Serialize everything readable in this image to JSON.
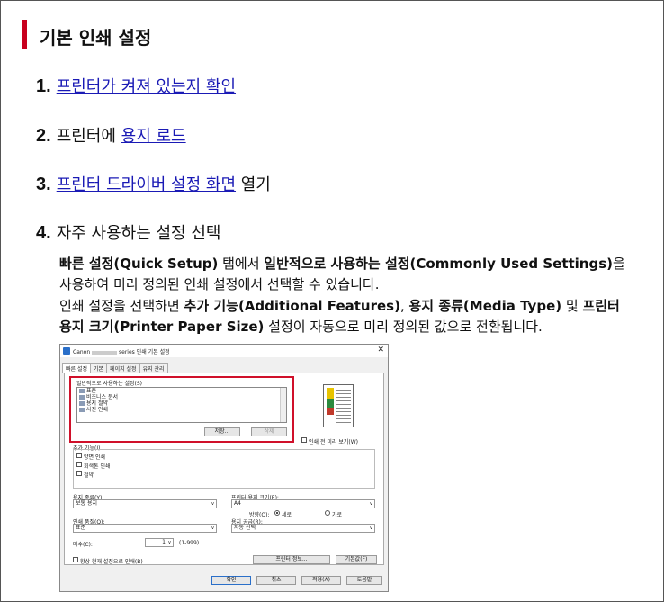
{
  "section_title": "기본 인쇄 설정",
  "steps": [
    {
      "num": "1.",
      "link": "프린터가 켜져 있는지 확인"
    },
    {
      "num": "2.",
      "prefix": "프린터에 ",
      "link": "용지 로드"
    },
    {
      "num": "3.",
      "link": "프린터 드라이버 설정 화면",
      "suffix": " 열기"
    },
    {
      "num": "4.",
      "text": "자주 사용하는 설정 선택"
    }
  ],
  "desc": {
    "p1_b1": "빠른 설정(Quick Setup)",
    "p1_t1": " 탭에서 ",
    "p1_b2": "일반적으로 사용하는 설정(Commonly Used Settings)",
    "p1_t2": "을 사용하여 미리 정의된 인쇄 설정에서 선택할 수 있습니다.",
    "p2_t1": "인쇄 설정을 선택하면 ",
    "p2_b1": "추가 기능(Additional Features)",
    "p2_t2": ", ",
    "p2_b2": "용지 종류(Media Type)",
    "p2_t3": " 및 ",
    "p2_b3": "프린터 용지 크기(Printer Paper Size)",
    "p2_t4": " 설정이 자동으로 미리 정의된 값으로 전환됩니다."
  },
  "dialog": {
    "title_prefix": "Canon",
    "title_suffix": "series 인쇄 기본 설정",
    "close": "✕",
    "tabs": [
      "빠른 설정",
      "기본",
      "페이지 설정",
      "유지 관리"
    ],
    "common_label": "일반적으로 사용하는 설정(S)",
    "list_items": [
      "표준",
      "비즈니스 문서",
      "용지 절약",
      "사진 인쇄"
    ],
    "save_btn": "저장...",
    "delete_btn": "삭제",
    "preview_check": "인쇄 전 미리 보기(W)",
    "additional_label": "추가 기능(I)",
    "additional_items": [
      "양면 인쇄",
      "회색톤 인쇄",
      "절약"
    ],
    "media_label": "용지 종류(Y):",
    "media_value": "보통 용지",
    "paper_size_label": "프린터 용지 크기(E):",
    "paper_size_value": "A4",
    "orientation_label": "방향(O):",
    "portrait": "세로",
    "landscape": "가로",
    "quality_label": "인쇄 품질(Q):",
    "quality_value": "표준",
    "source_label": "용지 공급(R):",
    "source_value": "자동 선택",
    "copies_label": "매수(C):",
    "copies_value": "1",
    "copies_range": "(1-999)",
    "always_check": "항상 현재 설정으로 인쇄(B)",
    "printer_info_btn": "프린터 정보...",
    "defaults_btn": "기본값(F)",
    "ok_btn": "확인",
    "cancel_btn": "취소",
    "apply_btn": "적용(A)",
    "help_btn": "도움말"
  }
}
